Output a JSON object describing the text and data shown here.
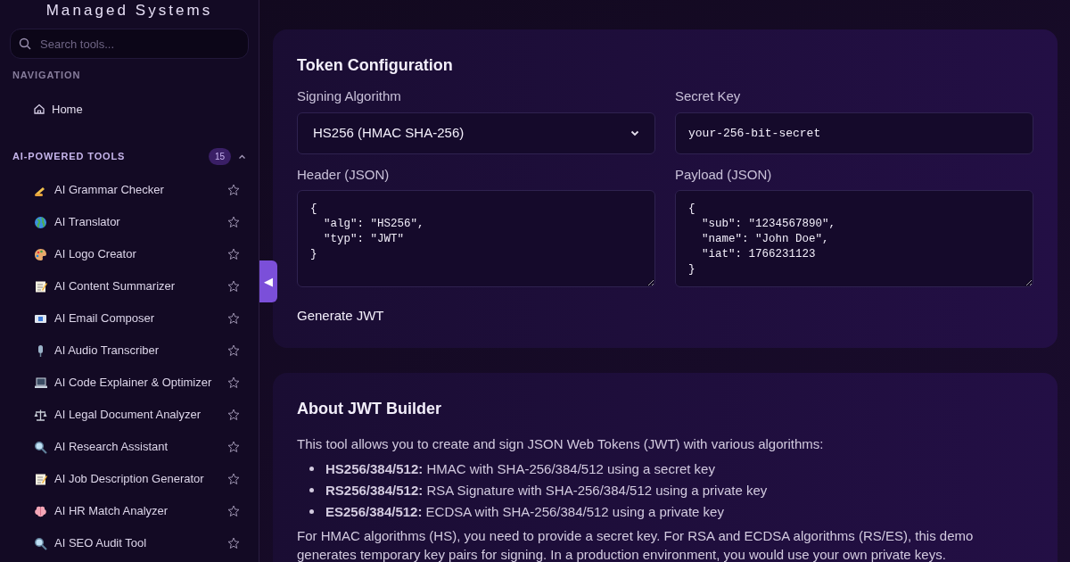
{
  "sidebar": {
    "brand": "Managed Systems",
    "search": {
      "placeholder": "Search tools..."
    },
    "navigation": {
      "heading": "NAVIGATION",
      "items": [
        {
          "label": "Home",
          "kind": "home"
        }
      ]
    },
    "section": {
      "heading": "AI-POWERED TOOLS",
      "count": "15",
      "expanded": true,
      "items": [
        {
          "label": "AI Grammar Checker",
          "kind": "pen",
          "favorite": false
        },
        {
          "label": "AI Translator",
          "kind": "globe",
          "favorite": false
        },
        {
          "label": "AI Logo Creator",
          "kind": "palette",
          "favorite": false
        },
        {
          "label": "AI Content Summarizer",
          "kind": "memo",
          "favorite": false
        },
        {
          "label": "AI Email Composer",
          "kind": "email",
          "favorite": false
        },
        {
          "label": "AI Audio Transcriber",
          "kind": "mic",
          "favorite": false
        },
        {
          "label": "AI Code Explainer & Optimizer",
          "kind": "laptop",
          "favorite": false
        },
        {
          "label": "AI Legal Document Analyzer",
          "kind": "scales",
          "favorite": false
        },
        {
          "label": "AI Research Assistant",
          "kind": "magnifier",
          "favorite": false
        },
        {
          "label": "AI Job Description Generator",
          "kind": "memo",
          "favorite": false
        },
        {
          "label": "AI HR Match Analyzer",
          "kind": "brain",
          "favorite": false
        },
        {
          "label": "AI SEO Audit Tool",
          "kind": "magnifier",
          "favorite": false
        }
      ]
    }
  },
  "collapse_button": {
    "label": "◀"
  },
  "token_configuration": {
    "title": "Token Configuration",
    "algorithm": {
      "label": "Signing Algorithm",
      "value": "HS256 (HMAC SHA-256)"
    },
    "secret": {
      "label": "Secret Key",
      "value": "your-256-bit-secret"
    },
    "header": {
      "label": "Header (JSON)",
      "value": "{\n  \"alg\": \"HS256\",\n  \"typ\": \"JWT\"\n}"
    },
    "payload": {
      "label": "Payload (JSON)",
      "value": "{\n  \"sub\": \"1234567890\",\n  \"name\": \"John Doe\",\n  \"iat\": 1766231123\n}"
    },
    "generate_button": "Generate JWT"
  },
  "about": {
    "title": "About JWT Builder",
    "intro": "This tool allows you to create and sign JSON Web Tokens (JWT) with various algorithms:",
    "bullets": [
      "**HS256/384/512:** HMAC with SHA-256/384/512 using a secret key",
      "**RS256/384/512:** RSA Signature with SHA-256/384/512 using a private key",
      "**ES256/384/512:** ECDSA with SHA-256/384/512 using a private key"
    ],
    "note": "For HMAC algorithms (HS), you need to provide a secret key. For RSA and ECDSA algorithms (RS/ES), this demo generates temporary key pairs for signing. In a production environment, you would use your own private keys."
  }
}
